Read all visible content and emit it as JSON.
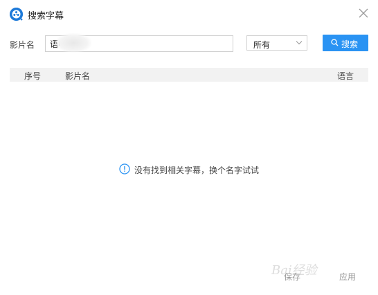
{
  "window": {
    "title": "搜索字幕",
    "icon": "film-reel-icon",
    "accent_color": "#1e7ad9"
  },
  "search": {
    "field_label": "影片名",
    "query_value": "语中字",
    "filter_selected": "所有",
    "search_button_label": "搜索",
    "button_color": "#2a93f3"
  },
  "table": {
    "columns": [
      "序号",
      "影片名",
      "语言"
    ],
    "rows": []
  },
  "empty_state": {
    "message": "没有找到相关字幕，换个名字试试",
    "icon": "info-circle-icon"
  },
  "footer": {
    "save_label": "保存",
    "apply_label": "应用"
  },
  "watermark": {
    "text": "Bai经验"
  }
}
